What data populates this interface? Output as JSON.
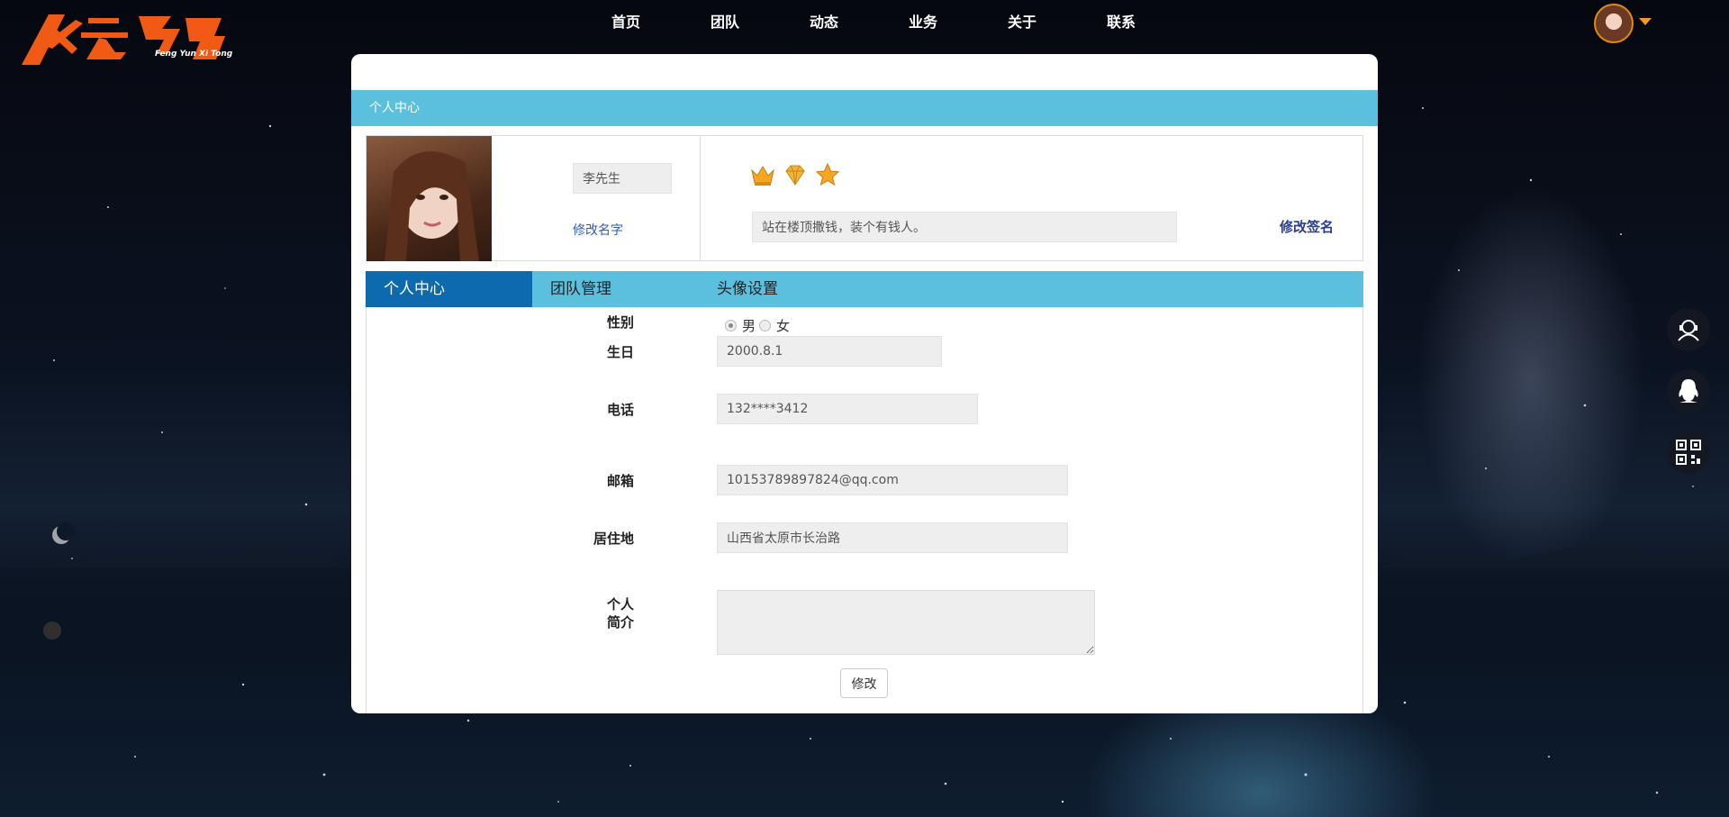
{
  "brand": {
    "logo_text": "风云系统",
    "logo_subtext": "Feng Yun Xi Tong",
    "accent": "#f05a14"
  },
  "nav": {
    "items": [
      {
        "label": "首页"
      },
      {
        "label": "团队"
      },
      {
        "label": "动态"
      },
      {
        "label": "业务"
      },
      {
        "label": "关于"
      },
      {
        "label": "联系"
      }
    ]
  },
  "user_menu": {
    "avatar_icon": "user-avatar",
    "caret_color": "#f39a1e"
  },
  "panel": {
    "header": "个人中心",
    "profile": {
      "name_value": "李先生",
      "edit_name": "修改名字",
      "badges": [
        "crown-icon",
        "diamond-icon",
        "star-icon"
      ],
      "signature_value": "站在楼顶撒钱，装个有钱人。",
      "edit_signature": "修改签名"
    },
    "tabs": [
      {
        "label": "个人中心",
        "active": true
      },
      {
        "label": "团队管理",
        "active": false
      },
      {
        "label": "头像设置",
        "active": false
      }
    ],
    "form": {
      "gender_label": "性别",
      "gender_options": [
        "男",
        "女"
      ],
      "gender_selected": "男",
      "birthday_label": "生日",
      "birthday_value": "2000.8.1",
      "phone_label": "电话",
      "phone_value": "132****3412",
      "email_label": "邮箱",
      "email_value": "10153789897824@qq.com",
      "address_label": "居住地",
      "address_value": "山西省太原市长治路",
      "bio_label_line1": "个人",
      "bio_label_line2": "简介",
      "bio_value": "",
      "submit_label": "修改"
    },
    "header_color": "#5bc0de",
    "active_tab_color": "#0d6aad"
  },
  "side_buttons": [
    {
      "icon": "customer-service-icon"
    },
    {
      "icon": "qq-penguin-icon"
    },
    {
      "icon": "qr-code-icon"
    }
  ]
}
